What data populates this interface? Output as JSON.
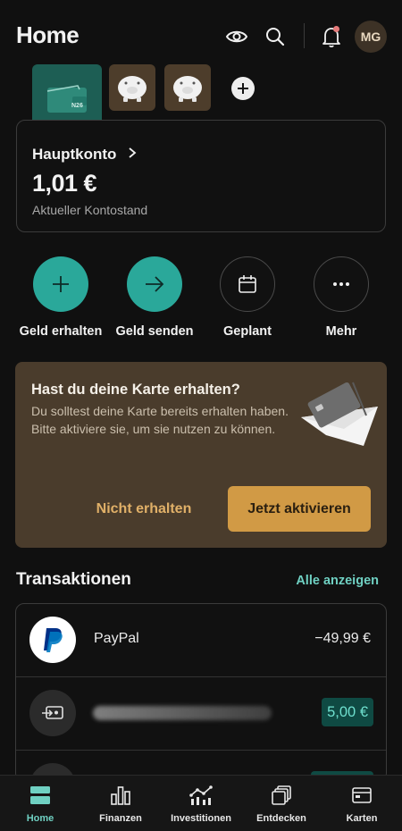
{
  "header": {
    "title": "Home",
    "avatar_initials": "MG",
    "icons": [
      "eye-icon",
      "search-icon",
      "bell-icon"
    ]
  },
  "spaces": {
    "main_card_text": "N26",
    "items": [
      "main-account",
      "piggy-bank",
      "piggy-bank"
    ]
  },
  "account": {
    "name": "Hauptkonto",
    "balance": "1,01 €",
    "subtitle": "Aktueller Kontostand"
  },
  "actions": [
    {
      "label": "Geld erhalten",
      "icon": "plus-icon"
    },
    {
      "label": "Geld senden",
      "icon": "arrow-right-icon"
    },
    {
      "label": "Geplant",
      "icon": "calendar-icon"
    },
    {
      "label": "Mehr",
      "icon": "more-icon"
    }
  ],
  "promo": {
    "title": "Hast du deine Karte erhalten?",
    "text": "Du solltest deine Karte bereits erhalten haben. Bitte aktiviere sie, um sie nutzen zu können.",
    "secondary_label": "Nicht erhalten",
    "primary_label": "Jetzt aktivieren"
  },
  "transactions": {
    "title": "Transaktionen",
    "show_all": "Alle anzeigen",
    "items": [
      {
        "name": "PayPal",
        "amount": "−49,99 €"
      },
      {
        "name": "",
        "amount": "5,00 €"
      }
    ]
  },
  "tabs": [
    {
      "label": "Home",
      "active": true
    },
    {
      "label": "Finanzen"
    },
    {
      "label": "Investitionen"
    },
    {
      "label": "Entdecken"
    },
    {
      "label": "Karten"
    }
  ],
  "colors": {
    "accent_teal": "#2aa89a",
    "promo_bg": "#4a3c2c",
    "primary_button": "#d19a45",
    "positive_bg": "#0f4a43"
  }
}
